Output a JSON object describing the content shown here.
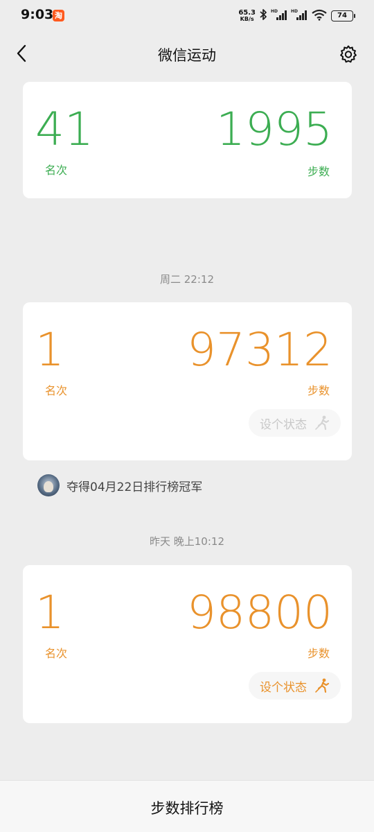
{
  "status_bar": {
    "time": "9:03",
    "app_badge": "淘",
    "net_speed_value": "65.3",
    "net_speed_unit": "KB/s",
    "battery": "74",
    "icons": [
      "taobao-icon",
      "bluetooth-icon",
      "signal-hd-icon",
      "signal-hd-icon",
      "wifi-icon",
      "battery-icon"
    ]
  },
  "nav": {
    "title": "微信运动",
    "back_icon": "back-chevron-icon",
    "settings_icon": "gear-icon"
  },
  "entries": [
    {
      "rank": "41",
      "rank_label": "名次",
      "steps": "1995",
      "steps_label": "步数",
      "color": "#3cad52"
    },
    {
      "time_label": "周二 22:12",
      "rank": "1",
      "rank_label": "名次",
      "steps": "97312",
      "steps_label": "步数",
      "status_button": "设个状态",
      "status_enabled": false,
      "color": "#e9922c"
    },
    {
      "time_label": "昨天 晚上10:12",
      "rank": "1",
      "rank_label": "名次",
      "steps": "98800",
      "steps_label": "步数",
      "status_button": "设个状态",
      "status_enabled": true,
      "color": "#e9922c"
    }
  ],
  "champion": {
    "text": "夺得04月22日排行榜冠军"
  },
  "bottom": {
    "label": "步数排行榜"
  },
  "colors": {
    "background": "#ededed",
    "card": "#ffffff",
    "green": "#3cad52",
    "orange": "#e9922c"
  }
}
